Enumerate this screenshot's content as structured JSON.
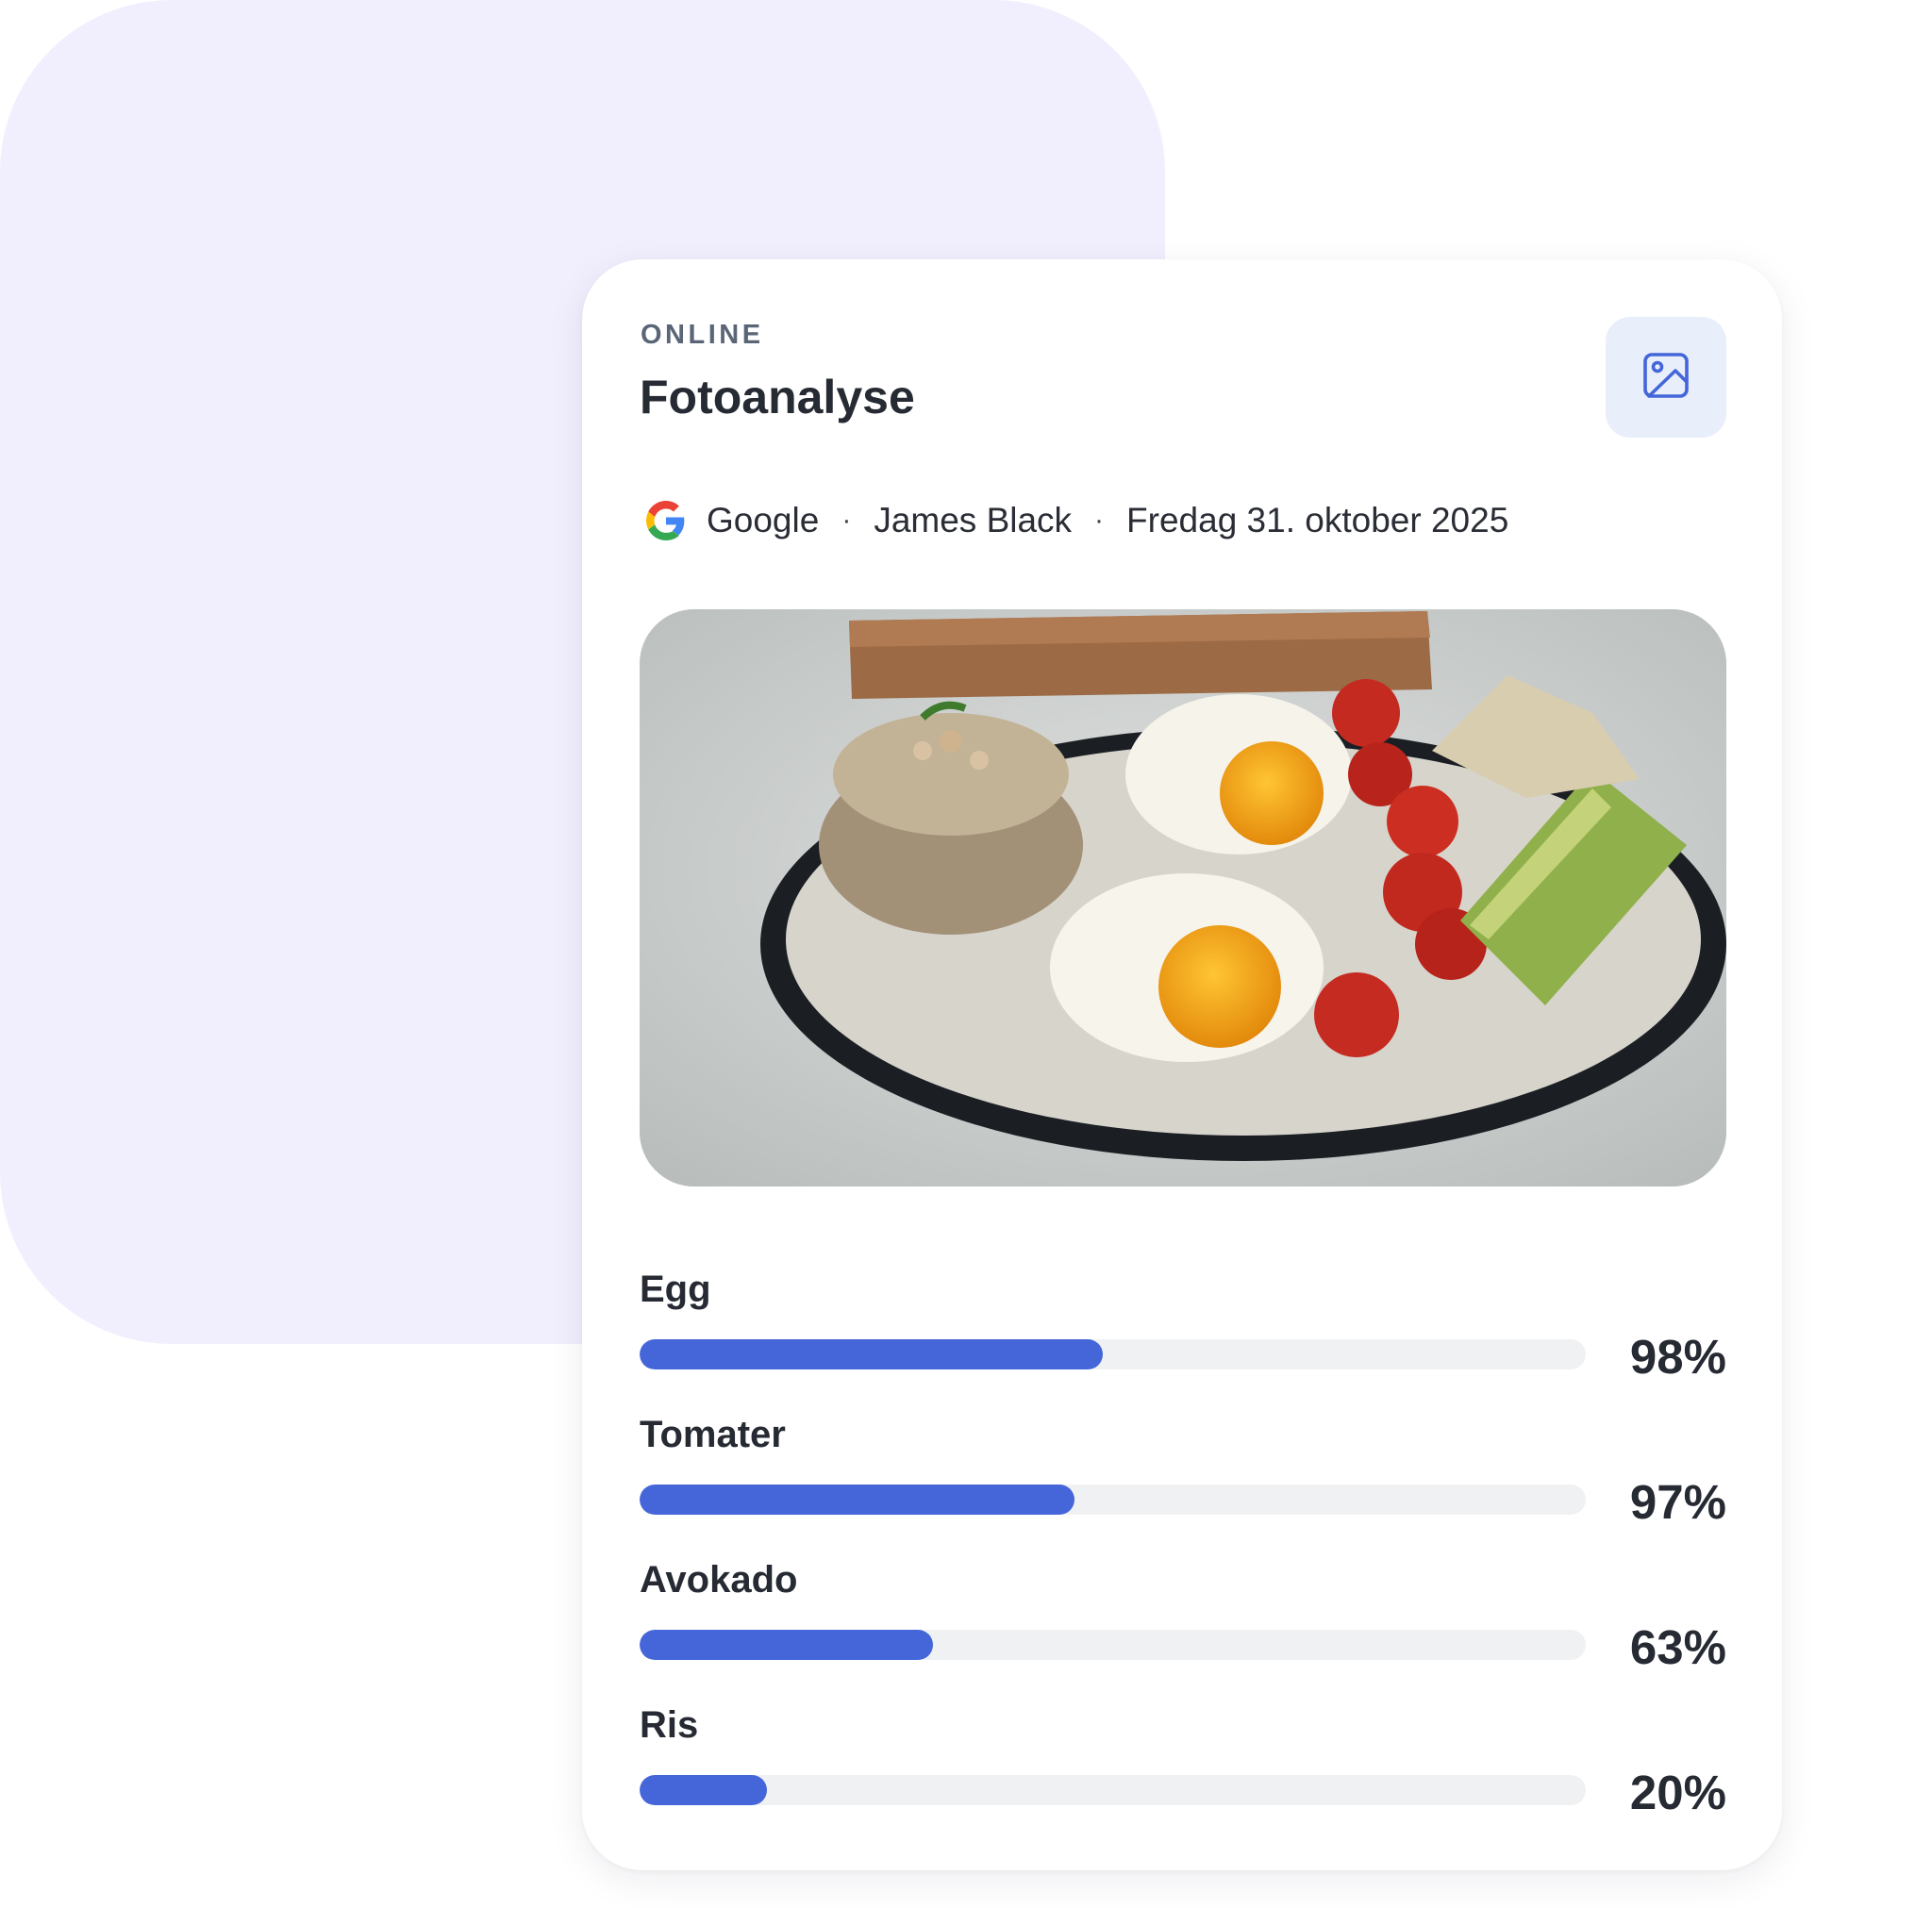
{
  "card": {
    "kicker": "ONLINE",
    "title": "Fotoanalyse",
    "action_icon": "image-icon"
  },
  "meta": {
    "source_icon": "google-logo-icon",
    "source": "Google",
    "separator": "·",
    "user": "James Black",
    "date": "Fredag 31. oktober 2025"
  },
  "photo": {
    "subject_icon": "food-plate-photo"
  },
  "results": [
    {
      "label": "Egg",
      "percent_text": "98%",
      "bar_fraction": 0.49
    },
    {
      "label": "Tomater",
      "percent_text": "97%",
      "bar_fraction": 0.46
    },
    {
      "label": "Avokado",
      "percent_text": "63%",
      "bar_fraction": 0.31
    },
    {
      "label": "Ris",
      "percent_text": "20%",
      "bar_fraction": 0.135
    }
  ],
  "colors": {
    "accent": "#4466d9",
    "track": "#f0f1f3",
    "background_blob": "#f1effd",
    "icon_button_bg": "#e9eefb",
    "text_primary": "#262a33",
    "text_muted": "#5a6577"
  }
}
